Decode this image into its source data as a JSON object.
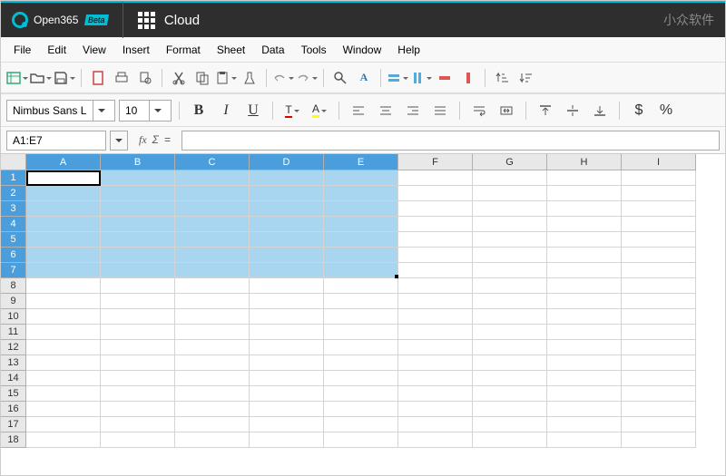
{
  "titlebar": {
    "brand": "Open365",
    "badge": "Beta",
    "app": "Cloud",
    "watermark": "小众软件"
  },
  "menu": [
    "File",
    "Edit",
    "View",
    "Insert",
    "Format",
    "Sheet",
    "Data",
    "Tools",
    "Window",
    "Help"
  ],
  "format": {
    "font": "Nimbus Sans L",
    "size": "10",
    "bold": "B",
    "italic": "I",
    "underline": "U",
    "fontcolor": "T",
    "highlight": "A"
  },
  "formula": {
    "namebox": "A1:E7",
    "fx": "fx",
    "sigma": "Σ",
    "eq": "="
  },
  "columns": [
    "A",
    "B",
    "C",
    "D",
    "E",
    "F",
    "G",
    "H",
    "I"
  ],
  "rows": [
    "1",
    "2",
    "3",
    "4",
    "5",
    "6",
    "7",
    "8",
    "9",
    "10",
    "11",
    "12",
    "13",
    "14",
    "15",
    "16",
    "17",
    "18"
  ],
  "selection": {
    "cols": 5,
    "rows": 7
  }
}
